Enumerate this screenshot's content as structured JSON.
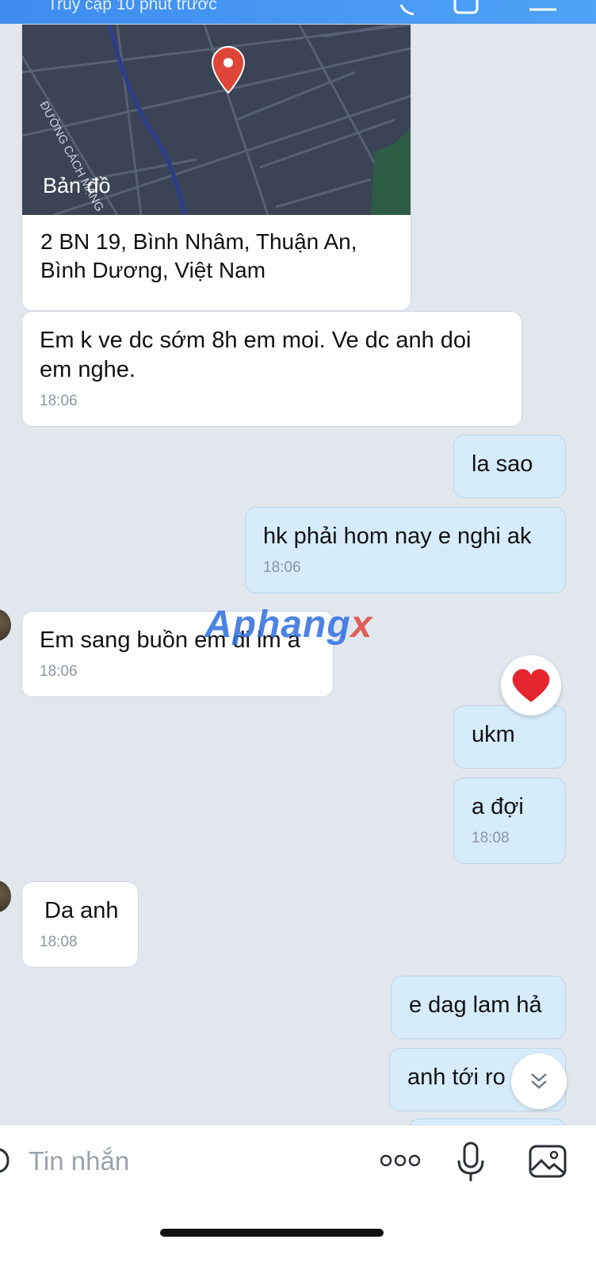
{
  "header": {
    "status": "Truy cập 10 phút trước"
  },
  "map": {
    "street_label": "ĐƯỜNG CÁCH MẠNG",
    "provider_label": "Bản đồ",
    "address": "2 BN 19, Bình Nhâm, Thuận An, Bình Dương, Việt Nam"
  },
  "messages": [
    {
      "dir": "in",
      "text": "Em k ve dc sớm 8h em moi. Ve dc anh doi em nghe.",
      "time": "18:06"
    },
    {
      "dir": "out",
      "text": "la sao",
      "time": ""
    },
    {
      "dir": "out",
      "text": "hk phải hom nay e nghi ak",
      "time": "18:06"
    },
    {
      "dir": "in",
      "text": "Em sang buồn em di lm a",
      "time": "18:06"
    },
    {
      "dir": "out",
      "text": "ukm",
      "time": "",
      "reaction": "❤"
    },
    {
      "dir": "out",
      "text": "a đợi",
      "time": "18:08"
    },
    {
      "dir": "in",
      "text": "Da anh",
      "time": "18:08"
    },
    {
      "dir": "out",
      "text": "e dag lam hả",
      "time": ""
    },
    {
      "dir": "out",
      "text": "anh tới ro",
      "time": ""
    }
  ],
  "watermark": {
    "part1": "Aphang",
    "part2": "x"
  },
  "composer": {
    "placeholder": "Tin nhắn"
  },
  "icons": {
    "more": "more-dots-icon",
    "mic": "microphone-icon",
    "gallery": "image-icon",
    "scroll": "scroll-down-icon"
  },
  "colors": {
    "header": "#3f8cf0",
    "outgoing_bubble": "#d6ecfb",
    "incoming_bubble": "#ffffff",
    "background": "#e2e7ee",
    "heart": "#e5262f"
  }
}
